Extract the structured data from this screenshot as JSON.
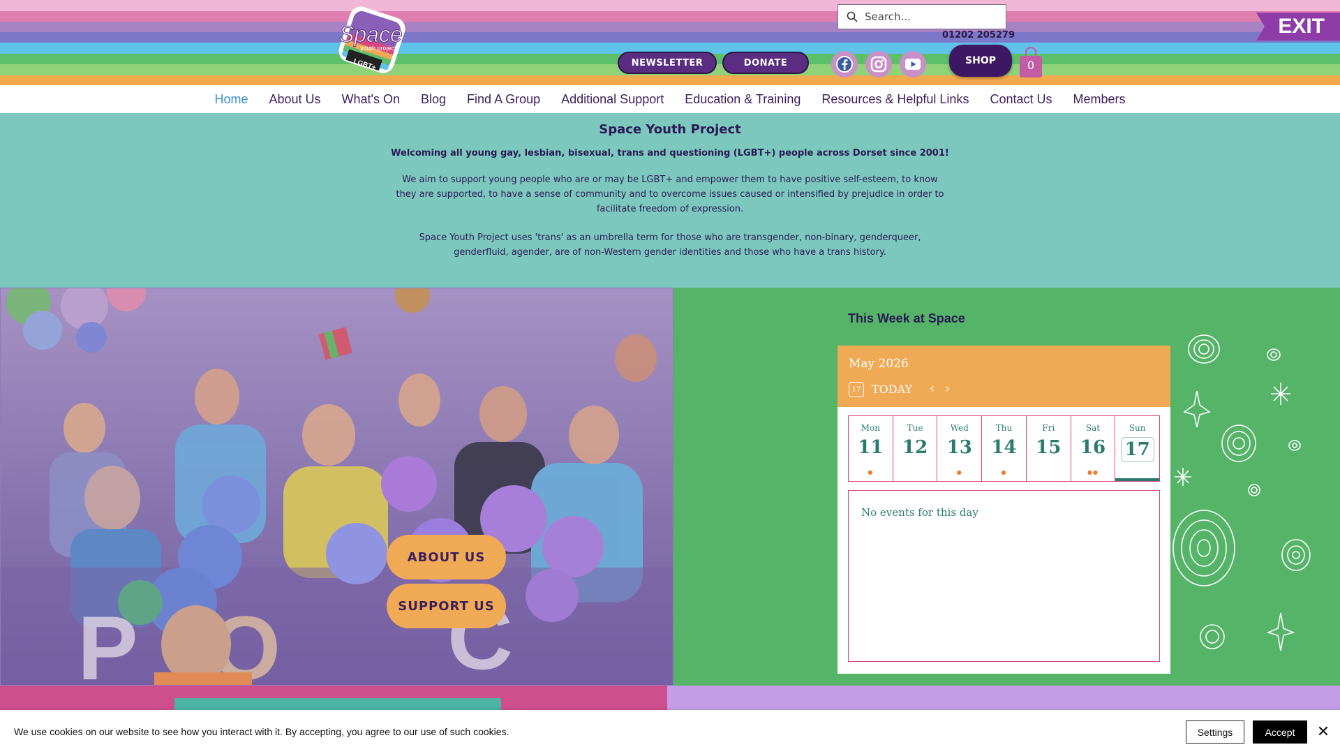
{
  "header": {
    "logo_alt": "Space youth project LGBT+",
    "search": {
      "placeholder": "Search...",
      "icon": "search-icon"
    },
    "phone": "01202 205279",
    "newsletter_label": "NEWSLETTER",
    "donate_label": "DONATE",
    "social": [
      {
        "name": "facebook-icon"
      },
      {
        "name": "instagram-icon"
      },
      {
        "name": "youtube-icon"
      }
    ],
    "shop_label": "SHOP",
    "cart_count": "0",
    "exit_label": "EXIT"
  },
  "nav": {
    "items": [
      "Home",
      "About Us",
      "What's On",
      "Blog",
      "Find A Group",
      "Additional Support",
      "Education & Training",
      "Resources & Helpful Links",
      "Contact Us",
      "Members"
    ],
    "active": "Home"
  },
  "intro": {
    "title": "Space Youth Project",
    "tagline": "Welcoming all young gay, lesbian, bisexual, trans and questioning (LGBT+) people across Dorset since 2001!",
    "paragraph1": "We aim to support young people who are or may be LGBT+ and empower them to have positive self-esteem, to know they are supported, to have a sense of community and to overcome issues caused or intensified by prejudice in order to facilitate freedom of expression.",
    "paragraph2": "Space Youth Project uses 'trans' as an umbrella term for those who are transgender, non-binary, genderqueer, genderfluid, agender, are of non-Western gender identities and those who have a trans history."
  },
  "hero": {
    "about_label": "ABOUT US",
    "support_label": "SUPPORT US"
  },
  "events": {
    "title": "This Week at Space",
    "month": "May 2026",
    "today_icon_num": "17",
    "today_label": "TODAY",
    "days": [
      {
        "name": "Mon",
        "num": "11",
        "dots": "●"
      },
      {
        "name": "Tue",
        "num": "12",
        "dots": ""
      },
      {
        "name": "Wed",
        "num": "13",
        "dots": "●"
      },
      {
        "name": "Thu",
        "num": "14",
        "dots": "●"
      },
      {
        "name": "Fri",
        "num": "15",
        "dots": ""
      },
      {
        "name": "Sat",
        "num": "16",
        "dots": "●●"
      },
      {
        "name": "Sun",
        "num": "17",
        "dots": ""
      }
    ],
    "selected_day": "17",
    "no_events": "No events for this day"
  },
  "cookie": {
    "text": "We use cookies on our website to see how you interact with it. By accepting, you agree to our use of such cookies.",
    "settings_label": "Settings",
    "accept_label": "Accept"
  },
  "colors": {
    "brand_purple": "#5b2d82",
    "teal": "#7cc8be",
    "green": "#55b468",
    "orange": "#f0aa55",
    "pink": "#cf4e8d",
    "lavender": "#c59ce6"
  }
}
